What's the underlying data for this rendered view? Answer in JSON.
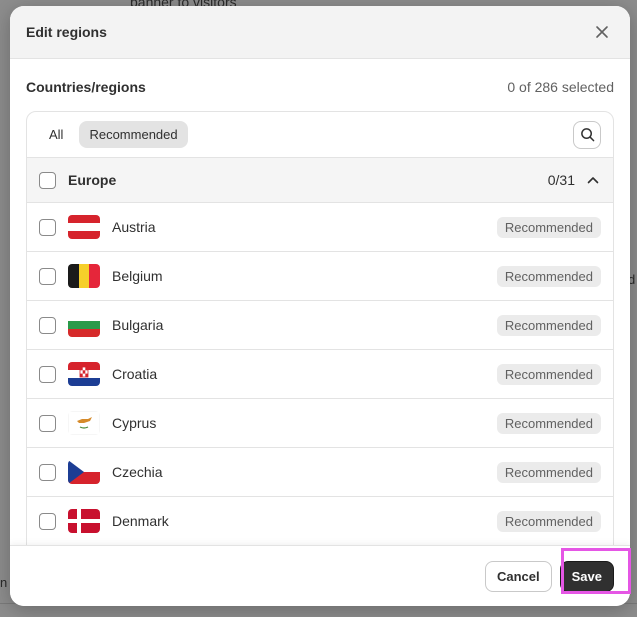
{
  "background": {
    "text_top": "banner to visitors",
    "text_right": "d",
    "text_left": "n"
  },
  "modal": {
    "title": "Edit regions",
    "close_icon": "close-icon"
  },
  "section": {
    "title": "Countries/regions",
    "selected_count": "0 of 286 selected"
  },
  "tabs": [
    {
      "label": "All",
      "active": false
    },
    {
      "label": "Recommended",
      "active": true
    }
  ],
  "group": {
    "label": "Europe",
    "count": "0/31"
  },
  "countries": [
    {
      "name": "Austria",
      "badge": "Recommended",
      "flag": "austria"
    },
    {
      "name": "Belgium",
      "badge": "Recommended",
      "flag": "belgium"
    },
    {
      "name": "Bulgaria",
      "badge": "Recommended",
      "flag": "bulgaria"
    },
    {
      "name": "Croatia",
      "badge": "Recommended",
      "flag": "croatia"
    },
    {
      "name": "Cyprus",
      "badge": "Recommended",
      "flag": "cyprus"
    },
    {
      "name": "Czechia",
      "badge": "Recommended",
      "flag": "czechia"
    },
    {
      "name": "Denmark",
      "badge": "Recommended",
      "flag": "denmark"
    }
  ],
  "footer": {
    "cancel_label": "Cancel",
    "save_label": "Save"
  },
  "colors": {
    "primary_button": "#303030",
    "highlight": "#e556e5"
  }
}
